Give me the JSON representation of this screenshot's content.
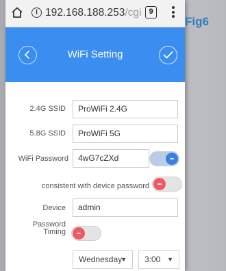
{
  "browser": {
    "url_main": "192.168.188.253",
    "url_faded": "/cgi",
    "tab_count": "9"
  },
  "header": {
    "title": "WiFi Setting"
  },
  "form": {
    "ssid_24_label": "2.4G SSID",
    "ssid_24_value": "ProWiFi 2.4G",
    "ssid_58_label": "5.8G SSID",
    "ssid_58_value": "ProWiFi 5G",
    "password_label": "WiFi Password",
    "password_value": "4wG7cZXd",
    "password_toggle": "on",
    "consistent_label": "consistent with device password",
    "consistent_toggle": "off",
    "device_label": "Device",
    "device_value": "admin",
    "timing_label_line1": "Password",
    "timing_label_line2": "Timing",
    "timing_toggle": "off",
    "day_value": "Wednesday",
    "time_value": "3:00"
  },
  "figure_label": "Fig6",
  "colors": {
    "header": "#3b8def",
    "toggle_on": "#3b7fe0",
    "toggle_off": "#ef5a62"
  }
}
